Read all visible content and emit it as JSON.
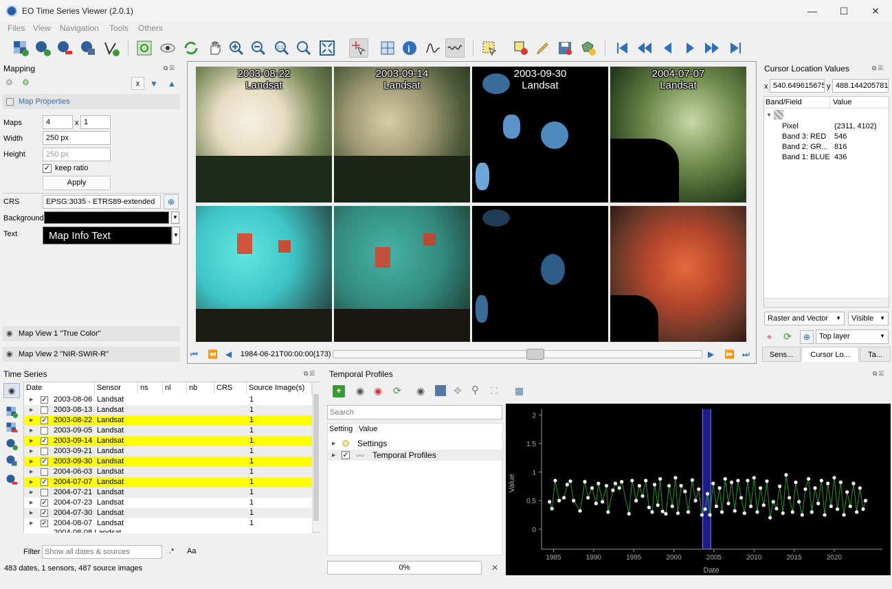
{
  "window": {
    "title": "EO Time Series Viewer (2.0.1)",
    "minimize": "—",
    "maximize": "☐",
    "close": "✕"
  },
  "menu": [
    "Files",
    "View",
    "Navigation",
    "Tools",
    "Others"
  ],
  "mapping": {
    "title": "Mapping",
    "x_button": "x",
    "map_properties": "Map Properties",
    "maps_label": "Maps",
    "maps_value": "4",
    "times": "x",
    "maps_value2": "1",
    "width_label": "Width",
    "width_value": "250 px",
    "height_label": "Height",
    "height_value": "250 px",
    "keep_ratio": "keep ratio",
    "apply": "Apply",
    "crs_label": "CRS",
    "crs_value": "EPSG:3035 - ETRS89-extended",
    "background_label": "Background",
    "text_label": "Text",
    "text_value": "Map Info Text",
    "view1": "Map View 1 \"True Color\"",
    "view2": "Map View 2 \"NIR-SWIR-R\""
  },
  "maps": {
    "dates": [
      "2003-08-22",
      "2003-09-14",
      "2003-09-30",
      "2004-07-07"
    ],
    "sensor": "Landsat",
    "time_label": "1984-06-21T00:00:00(173)",
    "slider_fraction": 0.55
  },
  "cursor": {
    "title": "Cursor Location Values",
    "x_label": "x",
    "x_value": "540.649615675",
    "y_label": "y",
    "y_value": "488.144205781",
    "col_band": "Band/Field",
    "col_value": "Value",
    "rows": [
      {
        "field": "Pixel",
        "value": "(2311, 4102)"
      },
      {
        "field": "Band 3: RED",
        "value": "546"
      },
      {
        "field": "Band 2: GR...",
        "value": "816"
      },
      {
        "field": "Band 1: BLUE",
        "value": "436"
      }
    ],
    "layer_type": "Raster and Vector",
    "visibility": "Visible",
    "layer_mode": "Top layer",
    "tabs": [
      "Sens...",
      "Cursor Lo...",
      "Ta..."
    ]
  },
  "timeseries": {
    "title": "Time Series",
    "columns": [
      "Date",
      "Sensor",
      "ns",
      "nl",
      "nb",
      "CRS",
      "Source Image(s)"
    ],
    "rows": [
      {
        "date": "2003-08-06",
        "sensor": "Landsat",
        "src": "1",
        "checked": true,
        "highlight": false
      },
      {
        "date": "2003-08-13",
        "sensor": "Landsat",
        "src": "1",
        "checked": false,
        "highlight": false
      },
      {
        "date": "2003-08-22",
        "sensor": "Landsat",
        "src": "1",
        "checked": true,
        "highlight": true
      },
      {
        "date": "2003-09-05",
        "sensor": "Landsat",
        "src": "1",
        "checked": false,
        "highlight": false
      },
      {
        "date": "2003-09-14",
        "sensor": "Landsat",
        "src": "1",
        "checked": true,
        "highlight": true
      },
      {
        "date": "2003-09-21",
        "sensor": "Landsat",
        "src": "1",
        "checked": false,
        "highlight": false
      },
      {
        "date": "2003-09-30",
        "sensor": "Landsat",
        "src": "1",
        "checked": true,
        "highlight": true
      },
      {
        "date": "2004-06-03",
        "sensor": "Landsat",
        "src": "1",
        "checked": false,
        "highlight": false
      },
      {
        "date": "2004-07-07",
        "sensor": "Landsat",
        "src": "1",
        "checked": true,
        "highlight": true
      },
      {
        "date": "2004-07-21",
        "sensor": "Landsat",
        "src": "1",
        "checked": false,
        "highlight": false
      },
      {
        "date": "2004-07-23",
        "sensor": "Landsat",
        "src": "1",
        "checked": true,
        "highlight": false
      },
      {
        "date": "2004-07-30",
        "sensor": "Landsat",
        "src": "1",
        "checked": true,
        "highlight": false
      },
      {
        "date": "2004-08-07",
        "sensor": "Landsat",
        "src": "1",
        "checked": true,
        "highlight": false
      }
    ],
    "filter_label": "Filter",
    "filter_placeholder": "Show all dates & sources",
    "regex": ".*",
    "case": "Aa",
    "status": "483 dates, 1 sensors, 487 source images"
  },
  "profiles": {
    "title": "Temporal Profiles",
    "search_placeholder": "Search",
    "col_setting": "Setting",
    "col_value": "Value",
    "tree": [
      "Settings",
      "Temporal Profiles"
    ],
    "progress": "0%",
    "progress_close": "✕"
  },
  "chart_data": {
    "type": "scatter",
    "xlabel": "Date",
    "ylabel": "Value",
    "xlim": [
      1983.5,
      2026
    ],
    "ylim": [
      -0.35,
      2.1
    ],
    "xticks": [
      1985,
      1990,
      1995,
      2000,
      2005,
      2010,
      2015,
      2020
    ],
    "yticks": [
      0,
      0.5,
      1,
      1.5,
      2
    ],
    "highlight_range": [
      2003.6,
      2004.6
    ],
    "points": [
      [
        1984.5,
        0.48
      ],
      [
        1984.8,
        0.36
      ],
      [
        1985.2,
        0.85
      ],
      [
        1985.7,
        0.5
      ],
      [
        1986.3,
        0.55
      ],
      [
        1986.7,
        0.78
      ],
      [
        1987.1,
        0.84
      ],
      [
        1987.5,
        0.5
      ],
      [
        1988.3,
        0.32
      ],
      [
        1988.9,
        0.83
      ],
      [
        1989.3,
        0.55
      ],
      [
        1989.8,
        0.72
      ],
      [
        1990.3,
        0.45
      ],
      [
        1990.6,
        0.8
      ],
      [
        1991.1,
        0.48
      ],
      [
        1991.6,
        0.76
      ],
      [
        1991.8,
        0.3
      ],
      [
        1992.4,
        0.68
      ],
      [
        1992.7,
        0.8
      ],
      [
        1993.2,
        0.72
      ],
      [
        1993.5,
        0.83
      ],
      [
        1994.4,
        0.27
      ],
      [
        1994.8,
        0.85
      ],
      [
        1995.3,
        0.5
      ],
      [
        1995.7,
        0.76
      ],
      [
        1996.1,
        0.58
      ],
      [
        1996.5,
        0.85
      ],
      [
        1996.9,
        0.38
      ],
      [
        1997.3,
        0.3
      ],
      [
        1997.6,
        0.78
      ],
      [
        1998.0,
        0.42
      ],
      [
        1998.3,
        0.88
      ],
      [
        1998.6,
        0.31
      ],
      [
        1999.0,
        0.27
      ],
      [
        1999.4,
        0.76
      ],
      [
        1999.8,
        0.4
      ],
      [
        2000.2,
        0.9
      ],
      [
        2000.5,
        0.28
      ],
      [
        2000.9,
        0.76
      ],
      [
        2001.4,
        0.66
      ],
      [
        2001.8,
        0.3
      ],
      [
        2002.3,
        0.86
      ],
      [
        2002.7,
        0.5
      ],
      [
        2003.1,
        0.7
      ],
      [
        2003.5,
        0.25
      ],
      [
        2003.9,
        0.35
      ],
      [
        2004.2,
        0.62
      ],
      [
        2004.5,
        0.25
      ],
      [
        2004.9,
        0.8
      ],
      [
        2005.3,
        0.4
      ],
      [
        2005.7,
        0.72
      ],
      [
        2006.0,
        0.3
      ],
      [
        2006.4,
        0.88
      ],
      [
        2006.8,
        0.45
      ],
      [
        2007.2,
        0.82
      ],
      [
        2007.6,
        0.32
      ],
      [
        2008.0,
        0.85
      ],
      [
        2008.4,
        0.55
      ],
      [
        2008.8,
        0.28
      ],
      [
        2009.2,
        0.85
      ],
      [
        2009.6,
        0.4
      ],
      [
        2010.0,
        0.9
      ],
      [
        2010.4,
        0.3
      ],
      [
        2010.8,
        0.72
      ],
      [
        2011.2,
        0.42
      ],
      [
        2011.6,
        0.84
      ],
      [
        2012.0,
        0.2
      ],
      [
        2012.4,
        0.48
      ],
      [
        2012.8,
        0.36
      ],
      [
        2013.2,
        0.75
      ],
      [
        2013.6,
        0.28
      ],
      [
        2014.0,
        0.95
      ],
      [
        2014.4,
        0.55
      ],
      [
        2014.8,
        0.3
      ],
      [
        2015.2,
        0.82
      ],
      [
        2015.6,
        0.48
      ],
      [
        2016.0,
        0.25
      ],
      [
        2016.4,
        0.7
      ],
      [
        2016.8,
        0.88
      ],
      [
        2017.2,
        0.3
      ],
      [
        2017.6,
        0.72
      ],
      [
        2018.0,
        0.45
      ],
      [
        2018.4,
        0.85
      ],
      [
        2018.8,
        0.25
      ],
      [
        2019.2,
        0.8
      ],
      [
        2019.6,
        0.4
      ],
      [
        2020.0,
        0.9
      ],
      [
        2020.4,
        0.35
      ],
      [
        2020.8,
        0.82
      ],
      [
        2021.2,
        0.25
      ],
      [
        2021.6,
        0.65
      ],
      [
        2022.0,
        0.4
      ],
      [
        2022.4,
        0.8
      ],
      [
        2022.8,
        0.3
      ],
      [
        2023.2,
        0.72
      ],
      [
        2023.6,
        0.35
      ],
      [
        2023.9,
        0.5
      ]
    ]
  }
}
